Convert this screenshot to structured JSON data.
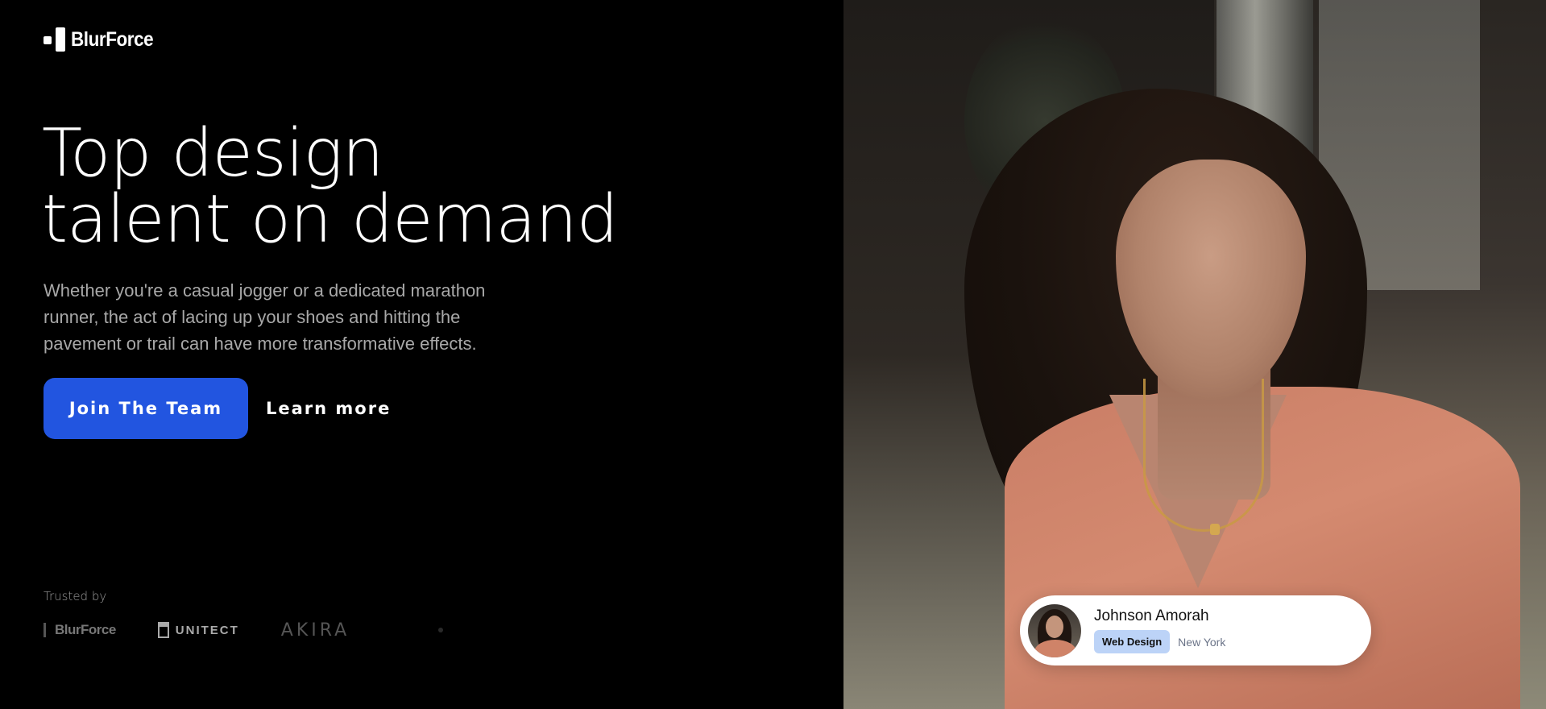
{
  "brand": {
    "name": "BlurForce"
  },
  "hero": {
    "headline_line1": "Top design",
    "headline_line2": "talent on demand",
    "subtext": "Whether you're a casual jogger or a dedicated marathon runner, the act of lacing up your shoes and hitting the pavement or trail can have more transformative effects.",
    "primary_button": "Join The Team",
    "secondary_link": "Learn more"
  },
  "trusted": {
    "label": "Trusted by",
    "logos": [
      {
        "name": "BlurForce"
      },
      {
        "name": "UNITECT"
      },
      {
        "name": "AKIRA"
      }
    ]
  },
  "profile_card": {
    "name": "Johnson Amorah",
    "tag": "Web Design",
    "location": "New York"
  },
  "colors": {
    "accent": "#2255e0",
    "background": "#000000",
    "tag_bg": "#bcd3f7"
  }
}
